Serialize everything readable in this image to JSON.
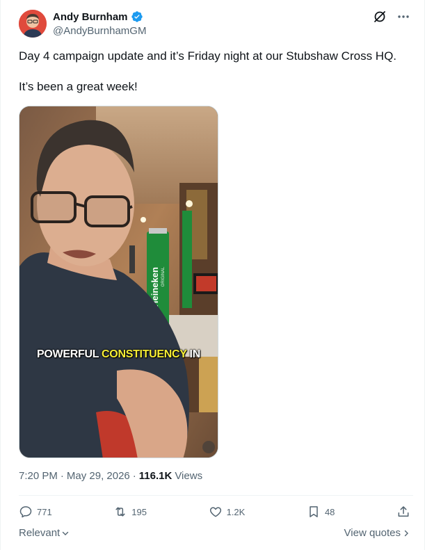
{
  "author": {
    "name": "Andy Burnham",
    "handle": "@AndyBurnhamGM",
    "verified_color": "#1d9bf0"
  },
  "top_icons": [
    "grok-icon",
    "more-icon"
  ],
  "tweet": {
    "text": "Day 4 campaign update and it’s Friday night at our Stubshaw Cross HQ.\n\nIt’s been a great week!"
  },
  "media": {
    "brand_text": "Heineken",
    "brand_sub": "ORIGINAL",
    "caption_word1": "POWERFUL",
    "caption_word2": "CONSTITUENCY",
    "caption_word3": "IN",
    "caption_highlight_color": "#f6ee35"
  },
  "meta": {
    "time": "7:20 PM",
    "separator1": "·",
    "date": "May 29, 2026",
    "separator2": "·",
    "views_count": "116.1K",
    "views_label": "Views"
  },
  "actions": {
    "replies": "771",
    "reposts": "195",
    "likes": "1.2K",
    "bookmarks": "48"
  },
  "footer": {
    "sort_label": "Relevant",
    "quotes_label": "View quotes"
  },
  "colors": {
    "text": "#0f1419",
    "secondary": "#536471",
    "border": "#eff3f4"
  }
}
